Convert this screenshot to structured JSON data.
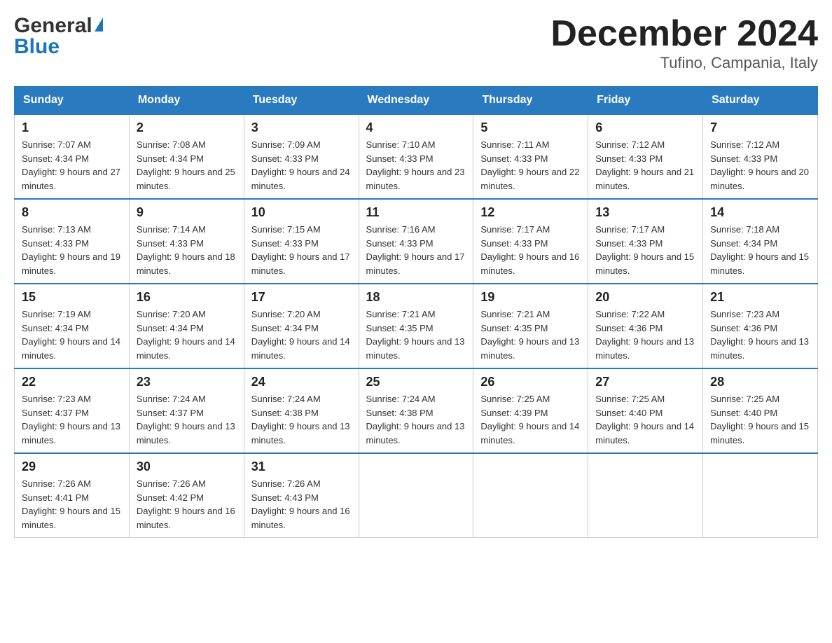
{
  "header": {
    "logo_top": "General",
    "logo_bottom": "Blue",
    "title": "December 2024",
    "subtitle": "Tufino, Campania, Italy"
  },
  "calendar": {
    "days_of_week": [
      "Sunday",
      "Monday",
      "Tuesday",
      "Wednesday",
      "Thursday",
      "Friday",
      "Saturday"
    ],
    "weeks": [
      [
        {
          "day": "1",
          "sunrise": "7:07 AM",
          "sunset": "4:34 PM",
          "daylight": "9 hours and 27 minutes."
        },
        {
          "day": "2",
          "sunrise": "7:08 AM",
          "sunset": "4:34 PM",
          "daylight": "9 hours and 25 minutes."
        },
        {
          "day": "3",
          "sunrise": "7:09 AM",
          "sunset": "4:33 PM",
          "daylight": "9 hours and 24 minutes."
        },
        {
          "day": "4",
          "sunrise": "7:10 AM",
          "sunset": "4:33 PM",
          "daylight": "9 hours and 23 minutes."
        },
        {
          "day": "5",
          "sunrise": "7:11 AM",
          "sunset": "4:33 PM",
          "daylight": "9 hours and 22 minutes."
        },
        {
          "day": "6",
          "sunrise": "7:12 AM",
          "sunset": "4:33 PM",
          "daylight": "9 hours and 21 minutes."
        },
        {
          "day": "7",
          "sunrise": "7:12 AM",
          "sunset": "4:33 PM",
          "daylight": "9 hours and 20 minutes."
        }
      ],
      [
        {
          "day": "8",
          "sunrise": "7:13 AM",
          "sunset": "4:33 PM",
          "daylight": "9 hours and 19 minutes."
        },
        {
          "day": "9",
          "sunrise": "7:14 AM",
          "sunset": "4:33 PM",
          "daylight": "9 hours and 18 minutes."
        },
        {
          "day": "10",
          "sunrise": "7:15 AM",
          "sunset": "4:33 PM",
          "daylight": "9 hours and 17 minutes."
        },
        {
          "day": "11",
          "sunrise": "7:16 AM",
          "sunset": "4:33 PM",
          "daylight": "9 hours and 17 minutes."
        },
        {
          "day": "12",
          "sunrise": "7:17 AM",
          "sunset": "4:33 PM",
          "daylight": "9 hours and 16 minutes."
        },
        {
          "day": "13",
          "sunrise": "7:17 AM",
          "sunset": "4:33 PM",
          "daylight": "9 hours and 15 minutes."
        },
        {
          "day": "14",
          "sunrise": "7:18 AM",
          "sunset": "4:34 PM",
          "daylight": "9 hours and 15 minutes."
        }
      ],
      [
        {
          "day": "15",
          "sunrise": "7:19 AM",
          "sunset": "4:34 PM",
          "daylight": "9 hours and 14 minutes."
        },
        {
          "day": "16",
          "sunrise": "7:20 AM",
          "sunset": "4:34 PM",
          "daylight": "9 hours and 14 minutes."
        },
        {
          "day": "17",
          "sunrise": "7:20 AM",
          "sunset": "4:34 PM",
          "daylight": "9 hours and 14 minutes."
        },
        {
          "day": "18",
          "sunrise": "7:21 AM",
          "sunset": "4:35 PM",
          "daylight": "9 hours and 13 minutes."
        },
        {
          "day": "19",
          "sunrise": "7:21 AM",
          "sunset": "4:35 PM",
          "daylight": "9 hours and 13 minutes."
        },
        {
          "day": "20",
          "sunrise": "7:22 AM",
          "sunset": "4:36 PM",
          "daylight": "9 hours and 13 minutes."
        },
        {
          "day": "21",
          "sunrise": "7:23 AM",
          "sunset": "4:36 PM",
          "daylight": "9 hours and 13 minutes."
        }
      ],
      [
        {
          "day": "22",
          "sunrise": "7:23 AM",
          "sunset": "4:37 PM",
          "daylight": "9 hours and 13 minutes."
        },
        {
          "day": "23",
          "sunrise": "7:24 AM",
          "sunset": "4:37 PM",
          "daylight": "9 hours and 13 minutes."
        },
        {
          "day": "24",
          "sunrise": "7:24 AM",
          "sunset": "4:38 PM",
          "daylight": "9 hours and 13 minutes."
        },
        {
          "day": "25",
          "sunrise": "7:24 AM",
          "sunset": "4:38 PM",
          "daylight": "9 hours and 13 minutes."
        },
        {
          "day": "26",
          "sunrise": "7:25 AM",
          "sunset": "4:39 PM",
          "daylight": "9 hours and 14 minutes."
        },
        {
          "day": "27",
          "sunrise": "7:25 AM",
          "sunset": "4:40 PM",
          "daylight": "9 hours and 14 minutes."
        },
        {
          "day": "28",
          "sunrise": "7:25 AM",
          "sunset": "4:40 PM",
          "daylight": "9 hours and 15 minutes."
        }
      ],
      [
        {
          "day": "29",
          "sunrise": "7:26 AM",
          "sunset": "4:41 PM",
          "daylight": "9 hours and 15 minutes."
        },
        {
          "day": "30",
          "sunrise": "7:26 AM",
          "sunset": "4:42 PM",
          "daylight": "9 hours and 16 minutes."
        },
        {
          "day": "31",
          "sunrise": "7:26 AM",
          "sunset": "4:43 PM",
          "daylight": "9 hours and 16 minutes."
        },
        null,
        null,
        null,
        null
      ]
    ],
    "labels": {
      "sunrise": "Sunrise: ",
      "sunset": "Sunset: ",
      "daylight": "Daylight: "
    }
  }
}
